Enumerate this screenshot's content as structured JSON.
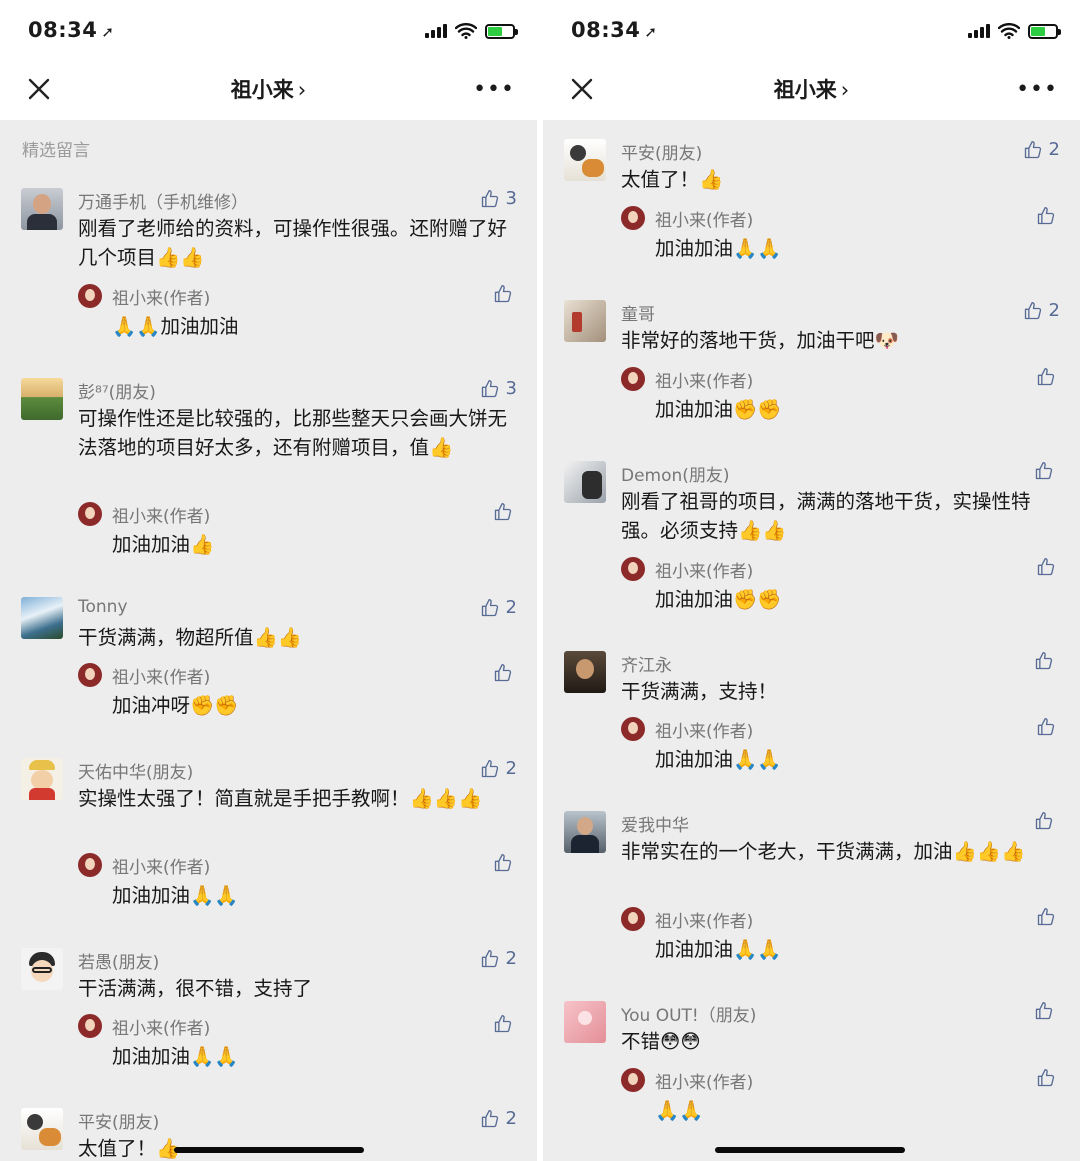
{
  "left": {
    "time": "08:34",
    "nav_title": "祖小来",
    "section_label": "精选留言",
    "comments": [
      {
        "name": "万通手机（手机维修）",
        "likes": "3",
        "text": "刚看了老师给的资料，可操作性很强。还附赠了好几个项目👍👍",
        "reply_name": "祖小来(作者)",
        "reply_text": "🙏🙏加油加油"
      },
      {
        "name": "彭⁸⁷(朋友)",
        "likes": "3",
        "text": "可操作性还是比较强的，比那些整天只会画大饼无法落地的项目好太多，还有附赠项目，值👍",
        "reply_name": "祖小来(作者)",
        "reply_text": "加油加油👍"
      },
      {
        "name": "Tonny",
        "likes": "2",
        "text": "干货满满，物超所值👍👍",
        "reply_name": "祖小来(作者)",
        "reply_text": "加油冲呀✊✊"
      },
      {
        "name": "天佑中华(朋友)",
        "likes": "2",
        "text": "实操性太强了！简直就是手把手教啊！👍👍👍",
        "reply_name": "祖小来(作者)",
        "reply_text": "加油加油🙏🙏"
      },
      {
        "name": "若愚(朋友)",
        "likes": "2",
        "text": "干活满满，很不错，支持了",
        "reply_name": "祖小来(作者)",
        "reply_text": "加油加油🙏🙏"
      },
      {
        "name": "平安(朋友)",
        "likes": "2",
        "text": "太值了！👍"
      }
    ]
  },
  "right": {
    "time": "08:34",
    "nav_title": "祖小来",
    "comments": [
      {
        "name": "平安(朋友)",
        "likes": "2",
        "text": "太值了！👍",
        "reply_name": "祖小来(作者)",
        "reply_text": "加油加油🙏🙏"
      },
      {
        "name": "童哥",
        "likes": "2",
        "text": "非常好的落地干货，加油干吧🐶",
        "reply_name": "祖小来(作者)",
        "reply_text": "加油加油✊✊"
      },
      {
        "name": "Demon(朋友)",
        "likes": "",
        "text": "刚看了祖哥的项目，满满的落地干货，实操性特强。必须支持👍👍",
        "reply_name": "祖小来(作者)",
        "reply_text": "加油加油✊✊"
      },
      {
        "name": "齐江永",
        "likes": "",
        "text": "干货满满，支持！",
        "reply_name": "祖小来(作者)",
        "reply_text": "加油加油🙏🙏"
      },
      {
        "name": "爱我中华",
        "likes": "",
        "text": "非常实在的一个老大，干货满满，加油👍👍👍",
        "reply_name": "祖小来(作者)",
        "reply_text": "加油加油🙏🙏"
      },
      {
        "name": "You OUT!（朋友)",
        "likes": "",
        "text": "不错😳😳",
        "reply_name": "祖小来(作者)",
        "reply_text": "🙏🙏"
      }
    ]
  },
  "colors": {
    "like_blue": "#576b95",
    "background": "#ededed",
    "battery_green": "#2ecc40"
  }
}
